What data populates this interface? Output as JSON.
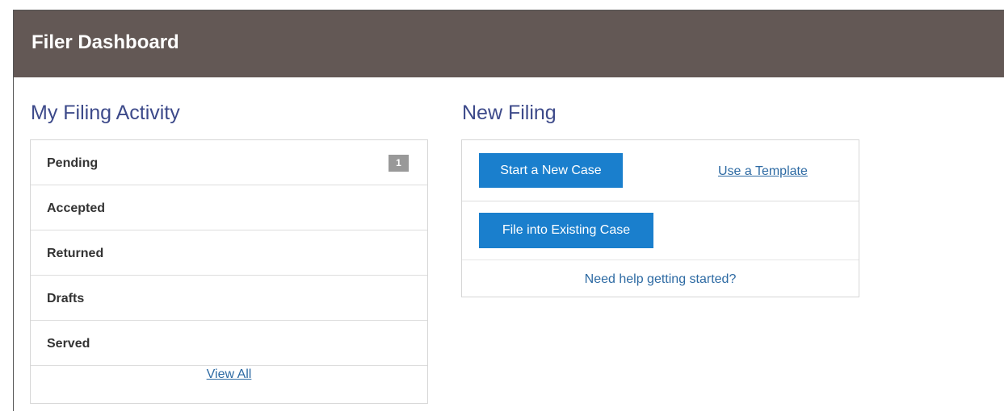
{
  "header": {
    "title": "Filer Dashboard"
  },
  "activity": {
    "title": "My Filing Activity",
    "items": [
      {
        "label": "Pending",
        "badge": "1"
      },
      {
        "label": "Accepted"
      },
      {
        "label": "Returned"
      },
      {
        "label": "Drafts"
      },
      {
        "label": "Served"
      }
    ],
    "view_all": "View All"
  },
  "new_filing": {
    "title": "New Filing",
    "start_case": "Start a New Case",
    "use_template": "Use a Template",
    "file_existing": "File into Existing Case",
    "help": "Need help getting started?"
  },
  "colors": {
    "header_bg": "#635855",
    "title_text": "#3d4a8a",
    "button_bg": "#1a7fcd",
    "link": "#2d6aa3",
    "badge_bg": "#999999"
  }
}
